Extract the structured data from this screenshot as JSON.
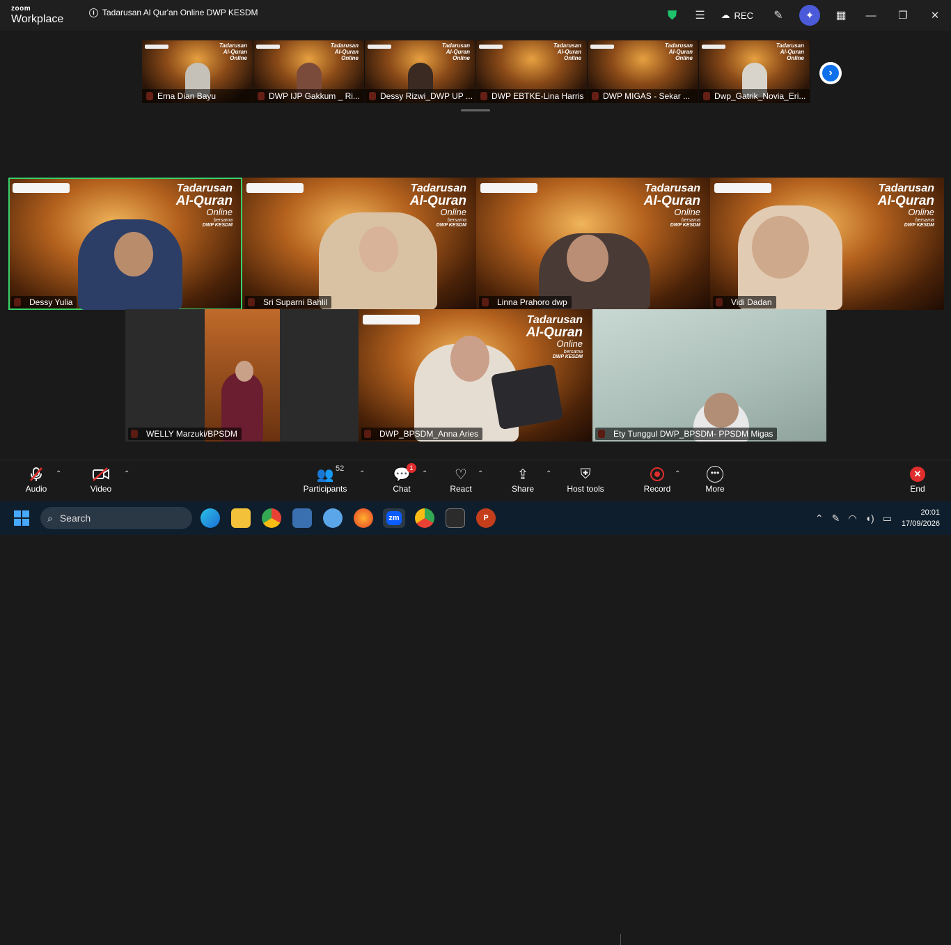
{
  "window": {
    "brand_line1": "zoom",
    "brand_line2": "Workplace",
    "meeting_title": "Tadarusan Al Qur'an Online DWP KESDM",
    "rec_label": "REC",
    "icons": [
      "shield-icon",
      "notes-icon",
      "cloud-icon",
      "pencil-icon",
      "ai-companion-icon",
      "apps-icon",
      "minimize-icon",
      "restore-icon",
      "close-icon"
    ]
  },
  "strip": {
    "participants": [
      "Erna Dian Bayu",
      "DWP IJP Gakkum _ Ri...",
      "Dessy Rizwi_DWP UP ...",
      "DWP EBTKE-Lina Harris",
      "DWP MIGAS - Sekar ...",
      "Dwp_Gatrik_Novia_Eri..."
    ]
  },
  "background": {
    "line1": "Tadarusan",
    "line2": "Al-Quran",
    "line3": "Online",
    "line4": "bersama",
    "line5": "DWP KESDM"
  },
  "gallery": {
    "participants": [
      "Dessy Yulia",
      "Sri Suparni Bahlil",
      "Linna Prahoro dwp",
      "Vidi Dadan",
      "WELLY Marzuki/BPSDM",
      "DWP_BPSDM_Anna Aries",
      "Ety Tunggul DWP_BPSDM- PPSDM Migas"
    ]
  },
  "toolbar": {
    "audio": "Audio",
    "video": "Video",
    "participants": "Participants",
    "participants_count": "52",
    "chat": "Chat",
    "chat_badge": "1",
    "react": "React",
    "share": "Share",
    "host_tools": "Host tools",
    "record": "Record",
    "more": "More",
    "end": "End"
  },
  "taskbar": {
    "search_placeholder": "Search",
    "time": "20:01",
    "date": "17/09/2026"
  },
  "colors": {
    "active_speaker": "#39d26a",
    "muted": "#e0452f",
    "accent": "#0e71eb"
  }
}
